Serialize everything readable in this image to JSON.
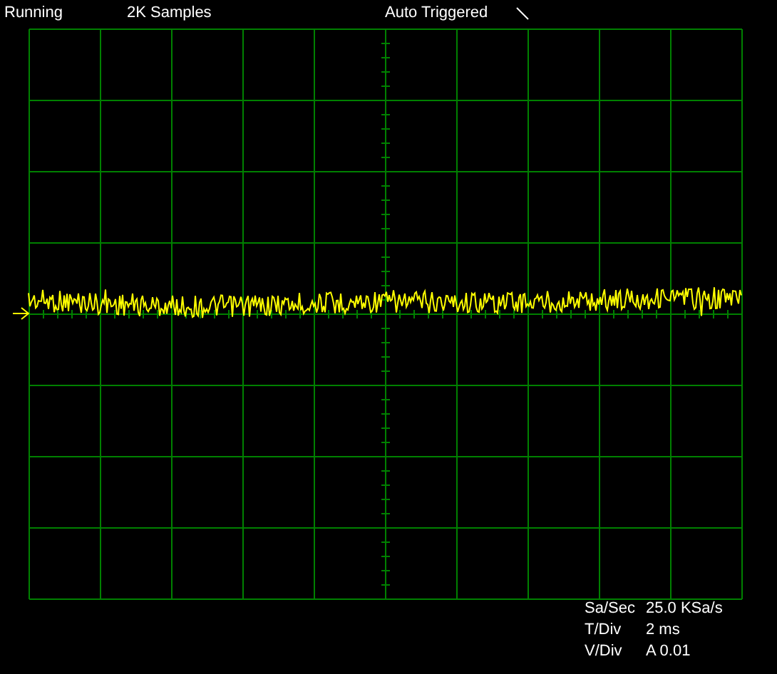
{
  "status_bar": {
    "run_state": "Running",
    "samples": "2K Samples",
    "trigger_mode": "Auto Triggered"
  },
  "readouts": [
    {
      "label": "Sa/Sec",
      "value": "25.0 KSa/s"
    },
    {
      "label": "T/Div",
      "value": "2 ms"
    },
    {
      "label": "V/Div",
      "value": "A 0.01"
    }
  ]
}
